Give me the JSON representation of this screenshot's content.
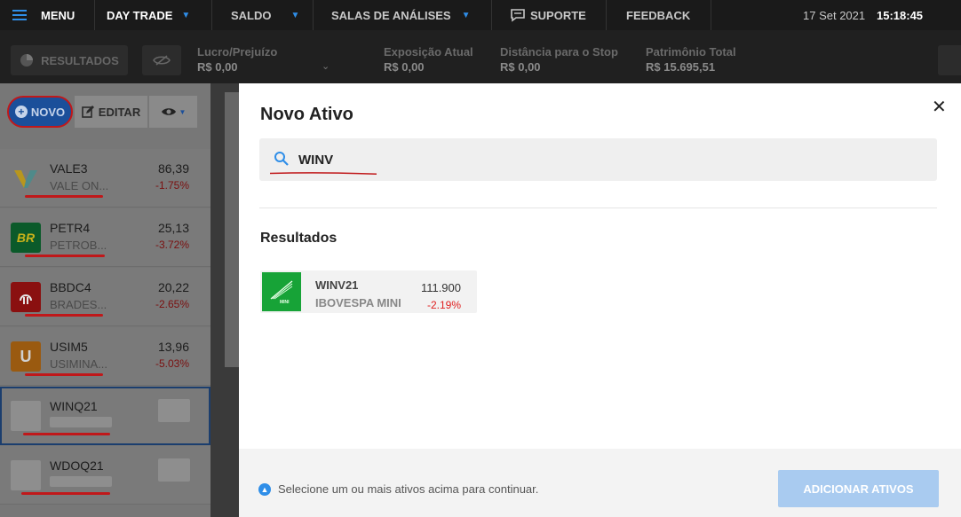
{
  "nav": {
    "menu": "MENU",
    "day_trade": "DAY TRADE",
    "saldo": "SALDO",
    "salas": "SALAS DE ANÁLISES",
    "suporte": "SUPORTE",
    "feedback": "FEEDBACK",
    "date": "17 Set 2021",
    "time": "15:18:45"
  },
  "bar": {
    "resultados": "RESULTADOS",
    "stats": [
      {
        "label": "Lucro/Prejuízo",
        "value": "R$ 0,00"
      },
      {
        "label": "Exposição Atual",
        "value": "R$ 0,00"
      },
      {
        "label": "Distância para o Stop",
        "value": "R$ 0,00"
      },
      {
        "label": "Patrimônio Total",
        "value": "R$ 15.695,51"
      }
    ]
  },
  "left": {
    "novo": "NOVO",
    "editar": "EDITAR",
    "assets": [
      {
        "ticker": "VALE3",
        "name": "VALE ON...",
        "price": "86,39",
        "change": "-1.75%"
      },
      {
        "ticker": "PETR4",
        "name": "PETROB...",
        "price": "25,13",
        "change": "-3.72%"
      },
      {
        "ticker": "BBDC4",
        "name": "BRADES...",
        "price": "20,22",
        "change": "-2.65%"
      },
      {
        "ticker": "USIM5",
        "name": "USIMINA...",
        "price": "13,96",
        "change": "-5.03%"
      },
      {
        "ticker": "WINQ21"
      },
      {
        "ticker": "WDOQ21"
      }
    ]
  },
  "modal": {
    "title": "Novo Ativo",
    "search_value": "WINV",
    "results_heading": "Resultados",
    "result": {
      "ticker": "WINV21",
      "name": "IBOVESPA MINI",
      "price": "111.900",
      "change": "-2.19%",
      "logo_text": "MINI"
    },
    "hint": "Selecione um ou mais ativos acima para continuar.",
    "add_button": "ADICIONAR ATIVOS"
  },
  "colors": {
    "accent": "#2f8ee8",
    "negative": "#e02020",
    "annotation": "#c0181a"
  }
}
